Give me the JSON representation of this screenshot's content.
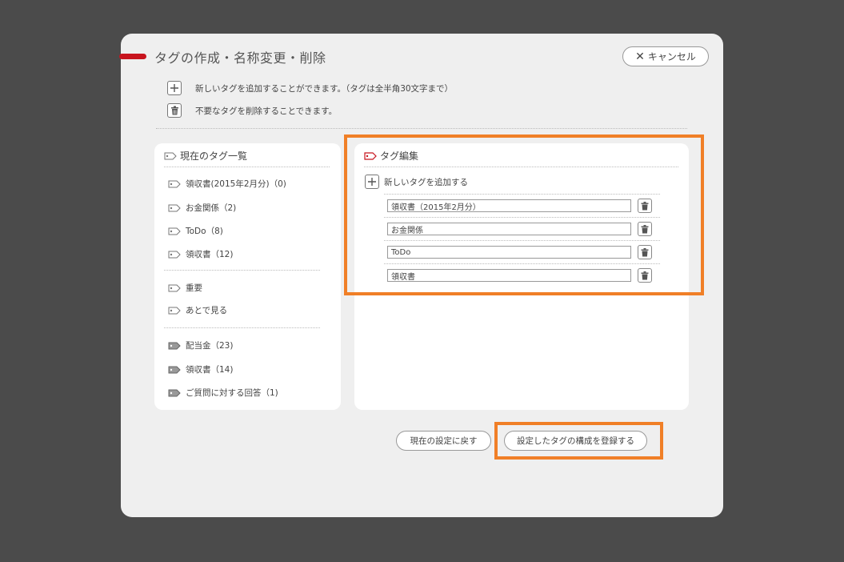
{
  "dialog": {
    "title": "タグの作成・名称変更・削除",
    "cancel_label": "キャンセル",
    "hints": [
      "新しいタグを追加することができます。（タグは全半角30文字まで）",
      "不要なタグを削除することできます。"
    ]
  },
  "current_tags": {
    "heading": "現在のタグ一覧",
    "group1": [
      "領収書(2015年2月分)（0)",
      "お金関係（2)",
      "ToDo（8)",
      "領収書（12)"
    ],
    "group2": [
      "重要",
      "あとで見る"
    ],
    "group3": [
      "配当金（23)",
      "領収書（14)",
      "ご質問に対する回答（1)"
    ]
  },
  "tag_edit": {
    "heading": "タグ編集",
    "add_label": "新しいタグを追加する",
    "inputs": [
      "領収書（2015年2月分）",
      "お金関係",
      "ToDo",
      "領収書"
    ]
  },
  "footer": {
    "revert_label": "現在の設定に戻す",
    "register_label": "設定したタグの構成を登録する"
  },
  "colors": {
    "accent": "#c8141e",
    "highlight": "#f07f27",
    "background": "#4b4b4b",
    "dialog": "#efefef"
  }
}
